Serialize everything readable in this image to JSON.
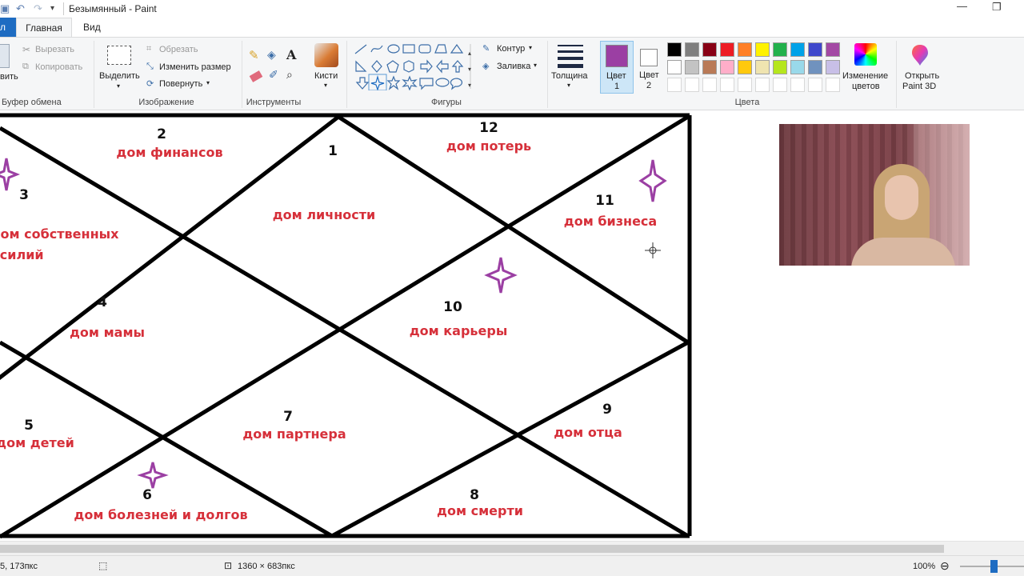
{
  "window": {
    "title": "Безымянный - Paint"
  },
  "tabs": {
    "file": "л",
    "home": "Главная",
    "view": "Вид"
  },
  "clipboard": {
    "paste_partial": "вить",
    "cut": "Вырезать",
    "copy": "Копировать",
    "group_label": "Буфер обмена"
  },
  "image": {
    "select": "Выделить",
    "crop": "Обрезать",
    "resize": "Изменить размер",
    "rotate": "Повернуть",
    "group_label": "Изображение"
  },
  "tools": {
    "group_label": "Инструменты",
    "text_icon_glyph": "A"
  },
  "brushes": {
    "label": "Кисти"
  },
  "shapes": {
    "outline": "Контур",
    "fill": "Заливка",
    "group_label": "Фигуры"
  },
  "thickness": {
    "label": "Толщина"
  },
  "color1": {
    "label_line1": "Цвет",
    "label_line2": "1",
    "value": "#9b3fa3"
  },
  "color2": {
    "label_line1": "Цвет",
    "label_line2": "2",
    "value": "#ffffff"
  },
  "palette": {
    "row1": [
      "#000000",
      "#7f7f7f",
      "#880015",
      "#ed1c24",
      "#ff7f27",
      "#fff200",
      "#22b14c",
      "#00a2e8",
      "#3f48cc",
      "#a349a4"
    ],
    "row2": [
      "#ffffff",
      "#c3c3c3",
      "#b97a57",
      "#ffaec9",
      "#ffc90e",
      "#efe4b0",
      "#b5e61d",
      "#99d9ea",
      "#7092be",
      "#c8bfe7"
    ],
    "group_label": "Цвета"
  },
  "edit_colors": {
    "line1": "Изменение",
    "line2": "цветов"
  },
  "paint3d": {
    "line1": "Открыть",
    "line2": "Paint 3D"
  },
  "chart": {
    "houses": [
      {
        "num": "1",
        "label": "дом личности"
      },
      {
        "num": "2",
        "label": "дом финансов"
      },
      {
        "num": "3",
        "label_line1": "дом собственных",
        "label_line2": "усилий"
      },
      {
        "num": "4",
        "label": "дом мамы"
      },
      {
        "num": "5",
        "label": "дом детей"
      },
      {
        "num": "6",
        "label": "дом болезней и долгов"
      },
      {
        "num": "7",
        "label": "дом партнера"
      },
      {
        "num": "8",
        "label": "дом смерти"
      },
      {
        "num": "9",
        "label": "дом отца"
      },
      {
        "num": "10",
        "label": "дом карьеры"
      },
      {
        "num": "11",
        "label": "дом бизнеса"
      },
      {
        "num": "12",
        "label": "дом потерь"
      }
    ],
    "star_color": "#9b3fa3",
    "text_color": "#d6303a"
  },
  "status": {
    "cursor_pos": "5, 173пкс",
    "canvas_size": "1360 × 683пкс",
    "zoom": "100%"
  }
}
